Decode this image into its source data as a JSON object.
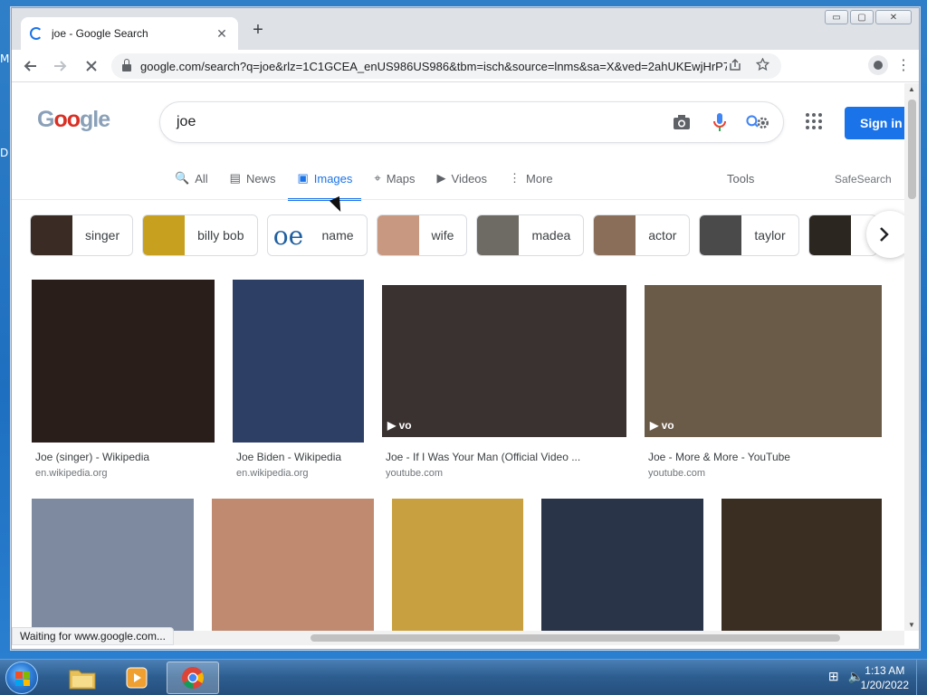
{
  "desktop": {
    "edge_glyph_1": "M",
    "edge_glyph_2": "D"
  },
  "browser": {
    "tab_title": "joe - Google Search",
    "tab_close": "✕",
    "new_tab": "+",
    "url": "google.com/search?q=joe&rlz=1C1GCEA_enUS986US986&tbm=isch&source=lnms&sa=X&ved=2ahUKEwjHrP7...",
    "window_controls": {
      "minimize": "▭",
      "maximize": "▢",
      "close": "✕"
    }
  },
  "google": {
    "logo_letters": [
      "G",
      "o",
      "o",
      "g",
      "l",
      "e"
    ],
    "query": "joe",
    "sign_in": "Sign in",
    "tabs": [
      {
        "icon": "🔍",
        "label": "All"
      },
      {
        "icon": "▤",
        "label": "News"
      },
      {
        "icon": "▣",
        "label": "Images"
      },
      {
        "icon": "⌖",
        "label": "Maps"
      },
      {
        "icon": "▶",
        "label": "Videos"
      },
      {
        "icon": "⋮",
        "label": "More"
      }
    ],
    "tools": "Tools",
    "safesearch": "SafeSearch"
  },
  "chips": [
    {
      "label": "singer",
      "color": "#3a2c25"
    },
    {
      "label": "billy bob",
      "color": "#c8a020"
    },
    {
      "label": "name",
      "color": "#ffffff",
      "glyph": "oe"
    },
    {
      "label": "wife",
      "color": "#c89880"
    },
    {
      "label": "madea",
      "color": "#6e6a64"
    },
    {
      "label": "actor",
      "color": "#8a6e5a"
    },
    {
      "label": "taylor",
      "color": "#4a4a4a"
    },
    {
      "label": "",
      "color": "#2c2620"
    }
  ],
  "results": [
    {
      "title": "Joe (singer) - Wikipedia",
      "source": "en.wikipedia.org",
      "color": "#2a1e1a",
      "badge": ""
    },
    {
      "title": "Joe Biden - Wikipedia",
      "source": "en.wikipedia.org",
      "color": "#2e3f66",
      "badge": ""
    },
    {
      "title": "Joe - If I Was Your Man (Official Video ...",
      "source": "youtube.com",
      "color": "#3a3230",
      "badge": "▶ vo"
    },
    {
      "title": "Joe - More & More - YouTube",
      "source": "youtube.com",
      "color": "#6a5a48",
      "badge": "▶ vo"
    }
  ],
  "row2_colors": [
    "#7d8aa0",
    "#c08a70",
    "#c9a040",
    "#2a3448",
    "#3a2e22"
  ],
  "status": "Waiting for www.google.com...",
  "taskbar": {
    "time": "1:13 AM",
    "date": "1/20/2022",
    "tray_network": "⊞",
    "tray_volume": "🔈"
  }
}
